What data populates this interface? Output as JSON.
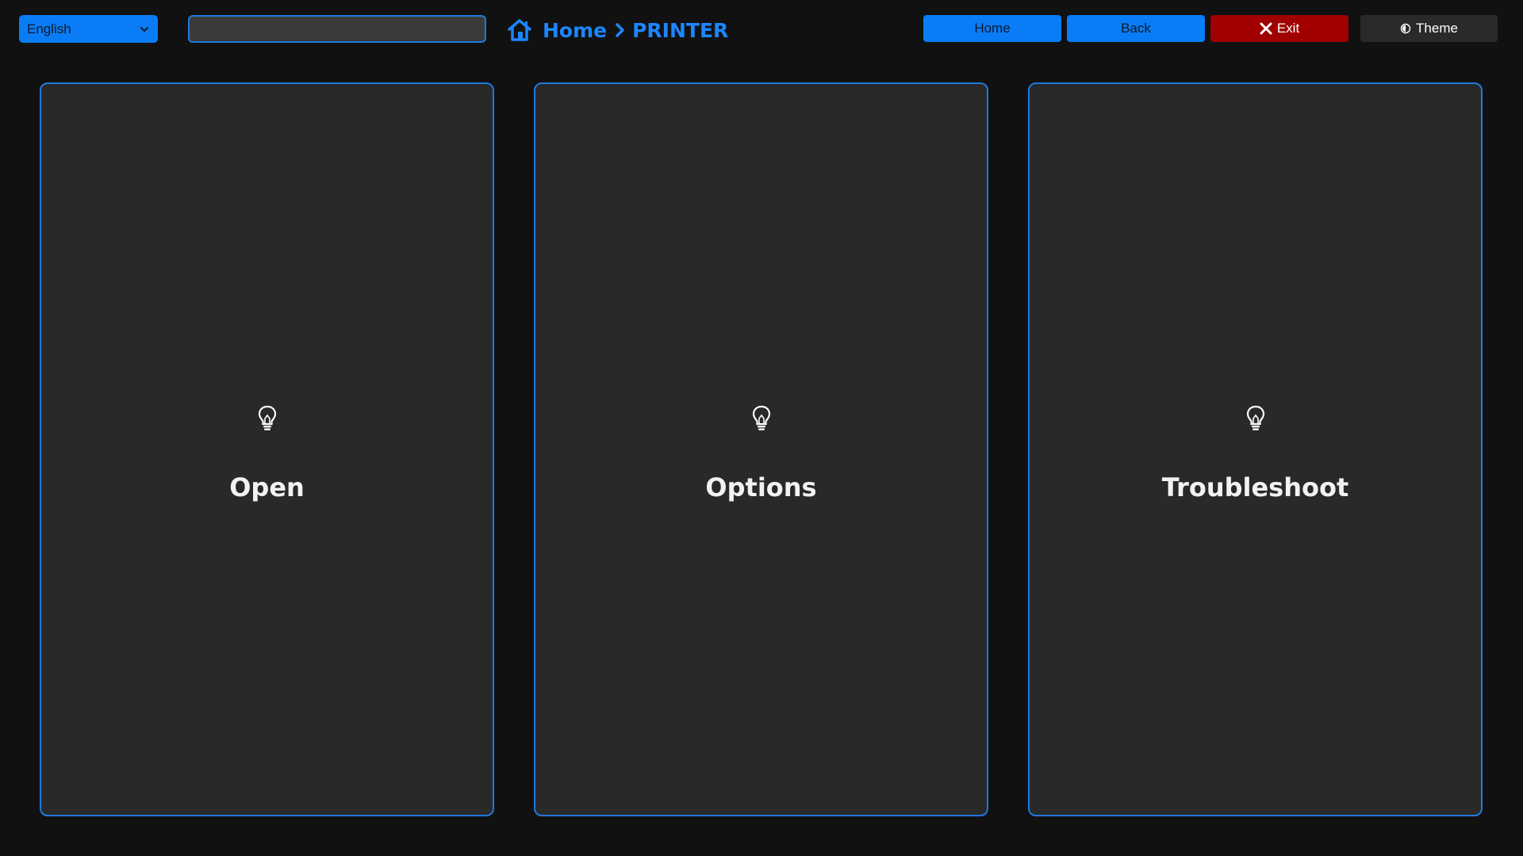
{
  "colors": {
    "background": "#111111",
    "accent": "#0a7cf5",
    "exit": "#a00000",
    "card_bg": "#292929"
  },
  "header": {
    "language": {
      "selected": "English",
      "icon": "chevron-down-icon"
    },
    "search": {
      "value": "",
      "placeholder": ""
    },
    "breadcrumb": {
      "icon": "home-icon",
      "items": [
        "Home",
        "PRINTER"
      ],
      "separator_icon": "chevron-right-icon"
    },
    "buttons": {
      "home": "Home",
      "back": "Back",
      "exit": {
        "label": "Exit",
        "icon": "close-icon"
      },
      "theme": {
        "label": "Theme",
        "icon": "theme-icon"
      }
    }
  },
  "cards": [
    {
      "label": "Open",
      "icon": "lightbulb-icon"
    },
    {
      "label": "Options",
      "icon": "lightbulb-icon"
    },
    {
      "label": "Troubleshoot",
      "icon": "lightbulb-icon"
    }
  ]
}
